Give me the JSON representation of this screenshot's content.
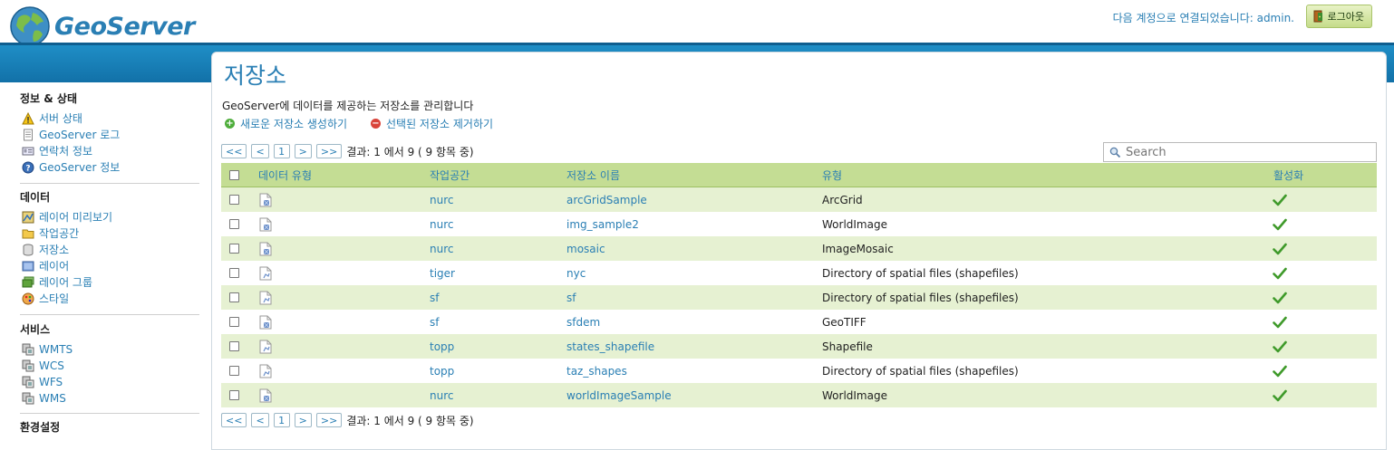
{
  "header": {
    "logo_text": "GeoServer",
    "login_text": "다음 계정으로 연결되었습니다: admin.",
    "logout_label": "로그아웃"
  },
  "sidebar": {
    "sections": [
      {
        "title": "정보 & 상태",
        "items": [
          {
            "label": "서버 상태",
            "icon": "warning-icon"
          },
          {
            "label": "GeoServer 로그",
            "icon": "document-icon"
          },
          {
            "label": "연락처 정보",
            "icon": "contact-card-icon"
          },
          {
            "label": "GeoServer 정보",
            "icon": "help-icon"
          }
        ]
      },
      {
        "title": "데이터",
        "items": [
          {
            "label": "레이어 미리보기",
            "icon": "map-preview-icon"
          },
          {
            "label": "작업공간",
            "icon": "folder-icon"
          },
          {
            "label": "저장소",
            "icon": "database-icon"
          },
          {
            "label": "레이어",
            "icon": "layer-icon"
          },
          {
            "label": "레이어 그룹",
            "icon": "layer-group-icon"
          },
          {
            "label": "스타일",
            "icon": "palette-icon"
          }
        ]
      },
      {
        "title": "서비스",
        "items": [
          {
            "label": "WMTS",
            "icon": "service-icon"
          },
          {
            "label": "WCS",
            "icon": "service-icon"
          },
          {
            "label": "WFS",
            "icon": "service-icon"
          },
          {
            "label": "WMS",
            "icon": "service-icon"
          }
        ]
      },
      {
        "title": "환경설정",
        "items": []
      }
    ]
  },
  "page": {
    "title": "저장소",
    "description": "GeoServer에 데이터를 제공하는 저장소를 관리합니다",
    "add_label": "새로운 저장소 생성하기",
    "remove_label": "선택된 저장소 제거하기"
  },
  "pager": {
    "first": "<<",
    "prev": "<",
    "page": "1",
    "next": ">",
    "last": ">>",
    "summary": "결과: 1 에서 9 ( 9 항목 중)"
  },
  "search": {
    "placeholder": "Search"
  },
  "table": {
    "headers": [
      "데이터 유형",
      "작업공간",
      "저장소 이름",
      "유형",
      "활성화"
    ],
    "rows": [
      {
        "kind": "raster",
        "workspace": "nurc",
        "name": "arcGridSample",
        "type": "ArcGrid",
        "enabled": true
      },
      {
        "kind": "raster",
        "workspace": "nurc",
        "name": "img_sample2",
        "type": "WorldImage",
        "enabled": true
      },
      {
        "kind": "raster",
        "workspace": "nurc",
        "name": "mosaic",
        "type": "ImageMosaic",
        "enabled": true
      },
      {
        "kind": "vector",
        "workspace": "tiger",
        "name": "nyc",
        "type": "Directory of spatial files (shapefiles)",
        "enabled": true
      },
      {
        "kind": "vector",
        "workspace": "sf",
        "name": "sf",
        "type": "Directory of spatial files (shapefiles)",
        "enabled": true
      },
      {
        "kind": "raster",
        "workspace": "sf",
        "name": "sfdem",
        "type": "GeoTIFF",
        "enabled": true
      },
      {
        "kind": "vector",
        "workspace": "topp",
        "name": "states_shapefile",
        "type": "Shapefile",
        "enabled": true
      },
      {
        "kind": "vector",
        "workspace": "topp",
        "name": "taz_shapes",
        "type": "Directory of spatial files (shapefiles)",
        "enabled": true
      },
      {
        "kind": "raster",
        "workspace": "nurc",
        "name": "worldImageSample",
        "type": "WorldImage",
        "enabled": true
      }
    ]
  }
}
